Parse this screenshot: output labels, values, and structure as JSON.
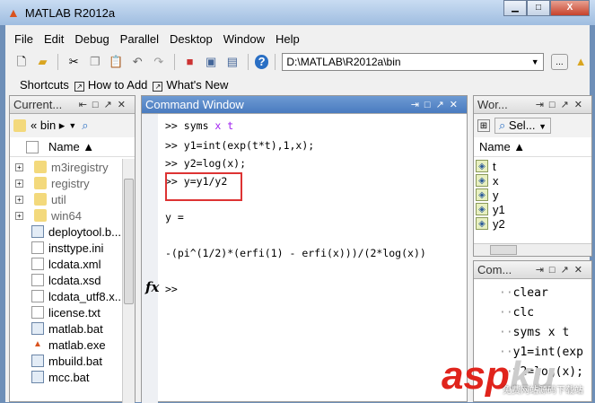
{
  "window": {
    "title": "MATLAB  R2012a",
    "minimize": "▁",
    "maximize": "□",
    "close": "X"
  },
  "menu": [
    "File",
    "Edit",
    "Debug",
    "Parallel",
    "Desktop",
    "Window",
    "Help"
  ],
  "toolbar": {
    "current_folder": "D:\\MATLAB\\R2012a\\bin",
    "browse": "...",
    "help": "?"
  },
  "shortcuts": {
    "label": "Shortcuts",
    "items": [
      "How to Add",
      "What's New"
    ]
  },
  "current_folder": {
    "title": "Current...",
    "breadcrumb": "« bin ▸",
    "column": "Name ▲",
    "items": [
      {
        "name": "m3iregistry",
        "type": "folder"
      },
      {
        "name": "registry",
        "type": "folder"
      },
      {
        "name": "util",
        "type": "folder"
      },
      {
        "name": "win64",
        "type": "folder"
      },
      {
        "name": "deploytool.b...",
        "type": "bat"
      },
      {
        "name": "insttype.ini",
        "type": "ini"
      },
      {
        "name": "lcdata.xml",
        "type": "file"
      },
      {
        "name": "lcdata.xsd",
        "type": "xsd"
      },
      {
        "name": "lcdata_utf8.x...",
        "type": "file"
      },
      {
        "name": "license.txt",
        "type": "txt"
      },
      {
        "name": "matlab.bat",
        "type": "bat"
      },
      {
        "name": "matlab.exe",
        "type": "exe"
      },
      {
        "name": "mbuild.bat",
        "type": "bat"
      },
      {
        "name": "mcc.bat",
        "type": "bat"
      }
    ]
  },
  "command_window": {
    "title": "Command Window",
    "lines": [
      {
        "prompt": ">>",
        "cmd": "syms ",
        "vars": "x t"
      },
      {
        "prompt": ">>",
        "cmd": "y1=int(exp(t*t),1,x);"
      },
      {
        "prompt": ">>",
        "cmd": "y2=log(x);"
      },
      {
        "prompt": ">>",
        "cmd": "y=y1/y2"
      }
    ],
    "output_label": "y =",
    "output_value": "-(pi^(1/2)*(erfi(1) - erfi(x)))/(2*log(x))",
    "fx": "fx",
    "prompt": ">>"
  },
  "workspace": {
    "title": "Wor...",
    "select": "Sel...",
    "column": "Name ▲",
    "vars": [
      "t",
      "x",
      "y",
      "y1",
      "y2"
    ]
  },
  "history": {
    "title": "Com...",
    "items": [
      "clear",
      "clc",
      "syms x t",
      "y1=int(exp",
      "y2=log(x);"
    ]
  },
  "watermark": {
    "text": "aspku",
    "sub": "免费网站源码下载站"
  }
}
